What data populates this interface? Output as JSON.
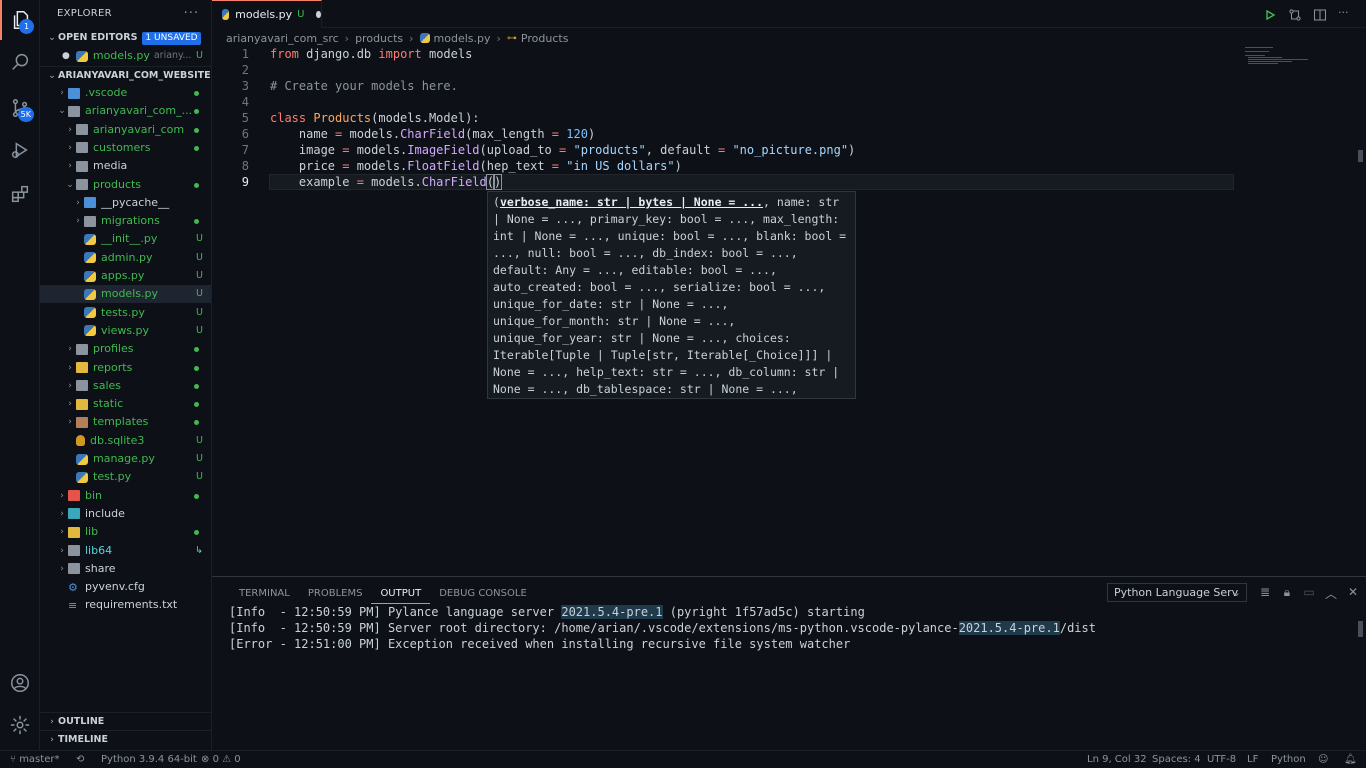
{
  "activity": {
    "source_control_badge": "5K",
    "explorer_badge": "1"
  },
  "sidebar": {
    "title": "EXPLORER",
    "open_editors_label": "OPEN EDITORS",
    "unsaved_label": "1 UNSAVED",
    "open_file": {
      "name": "models.py",
      "path": "ariany...",
      "status": "U"
    },
    "workspace_label": "ARIANYAVARI_COM_WEBSITE",
    "tree": [
      {
        "name": ".vscode",
        "status": "dot"
      },
      {
        "name": "arianyavari_com_...",
        "status": "dot"
      },
      {
        "name": "arianyavari_com",
        "status": "dot"
      },
      {
        "name": "customers",
        "status": "dot"
      },
      {
        "name": "media",
        "status": ""
      },
      {
        "name": "products",
        "status": "dot"
      },
      {
        "name": "__pycache__",
        "status": ""
      },
      {
        "name": "migrations",
        "status": "dot"
      },
      {
        "name": "__init__.py",
        "status": "U"
      },
      {
        "name": "admin.py",
        "status": "U"
      },
      {
        "name": "apps.py",
        "status": "U"
      },
      {
        "name": "models.py",
        "status": "U"
      },
      {
        "name": "tests.py",
        "status": "U"
      },
      {
        "name": "views.py",
        "status": "U"
      },
      {
        "name": "profiles",
        "status": "dot"
      },
      {
        "name": "reports",
        "status": "dot"
      },
      {
        "name": "sales",
        "status": "dot"
      },
      {
        "name": "static",
        "status": "dot"
      },
      {
        "name": "templates",
        "status": "dot"
      },
      {
        "name": "db.sqlite3",
        "status": "U"
      },
      {
        "name": "manage.py",
        "status": "U"
      },
      {
        "name": "test.py",
        "status": "U"
      },
      {
        "name": "bin",
        "status": "dot"
      },
      {
        "name": "include",
        "status": ""
      },
      {
        "name": "lib",
        "status": "dot"
      },
      {
        "name": "lib64",
        "status": "↳"
      },
      {
        "name": "share",
        "status": ""
      },
      {
        "name": "pyvenv.cfg",
        "status": ""
      },
      {
        "name": "requirements.txt",
        "status": ""
      }
    ],
    "outline_label": "OUTLINE",
    "timeline_label": "TIMELINE"
  },
  "editor": {
    "tab": {
      "name": "models.py",
      "status": "U"
    },
    "breadcrumbs": [
      "arianyavari_com_src",
      "products",
      "models.py",
      "Products"
    ],
    "line_numbers": [
      "1",
      "2",
      "3",
      "4",
      "5",
      "6",
      "7",
      "8",
      "9"
    ],
    "hint_lines": [
      "verbose_name: str | bytes | None = ...",
      ", name: str",
      "| None = ..., primary_key: bool = ..., max_length:",
      "int | None = ..., unique: bool = ..., blank: bool =",
      "..., null: bool = ..., db_index: bool = ...,",
      "default: Any = ..., editable: bool = ...,",
      "auto_created: bool = ..., serialize: bool = ...,",
      "unique_for_date: str | None = ...,",
      "unique_for_month: str | None = ...,",
      "unique_for_year: str | None = ..., choices:",
      "Iterable[Tuple | Tuple[str, Iterable[_Choice]]] |",
      "None = ..., help_text: str = ..., db_column: str |",
      "None = ..., db_tablespace: str | None = ...,"
    ]
  },
  "panel": {
    "tabs": [
      "TERMINAL",
      "PROBLEMS",
      "OUTPUT",
      "DEBUG CONSOLE"
    ],
    "active_tab": "OUTPUT",
    "channel": "Python Language Serv",
    "output": [
      {
        "pre": "[Info  - 12:50:59 PM] Pylance language server ",
        "hl": "2021.5.4-pre.1",
        "post": " (pyright 1f57ad5c) starting"
      },
      {
        "pre": "[Info  - 12:50:59 PM] Server root directory: /home/arian/.vscode/extensions/ms-python.vscode-pylance-",
        "hl": "2021.5.4-pre.1",
        "post": "/dist"
      },
      {
        "pre": "[Error - 12:51:00 PM] Exception received when installing recursive file system watcher",
        "hl": "",
        "post": ""
      }
    ]
  },
  "status": {
    "branch": "master*",
    "python": "Python 3.9.4 64-bit",
    "errors": "0",
    "warnings": "0",
    "position": "Ln 9, Col 32",
    "spaces": "Spaces: 4",
    "encoding": "UTF-8",
    "eol": "LF",
    "language": "Python"
  },
  "colors": {
    "accent": "#f78166",
    "badge": "#1f6feb",
    "untracked": "#3fb950"
  }
}
